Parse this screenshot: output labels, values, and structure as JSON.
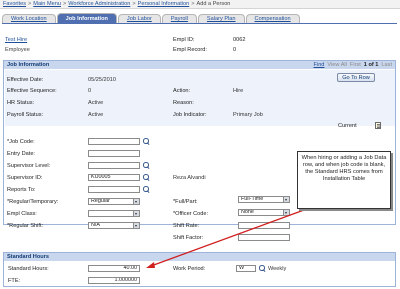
{
  "menubar": {
    "items": [
      "Favorites",
      "Main Menu",
      "Workforce Administration",
      "Personal Information",
      "Add a Person"
    ],
    "separator": ">"
  },
  "tabs": [
    {
      "label": "Work Location",
      "active": false
    },
    {
      "label": "Job Information",
      "active": true
    },
    {
      "label": "Job Labor",
      "active": false
    },
    {
      "label": "Payroll",
      "active": false
    },
    {
      "label": "Salary Plan",
      "active": false
    },
    {
      "label": "Compensation",
      "active": false
    }
  ],
  "header": {
    "name": "Test Hire",
    "role": "Employee",
    "empl_id_label": "Empl ID:",
    "empl_id_value": "0062",
    "empl_record_label": "Empl Record:",
    "empl_record_value": "0"
  },
  "job_panel": {
    "title": "Job Information",
    "nav": {
      "find": "Find",
      "view_all": "View All",
      "first": "First",
      "counter": "1 of 1",
      "last": "Last"
    },
    "go_to_row": "Go To Row",
    "effective_date_label": "Effective Date:",
    "effective_date_value": "05/25/2010",
    "effective_seq_label": "Effective Sequence:",
    "effective_seq_value": "0",
    "action_label": "Action:",
    "action_value": "Hire",
    "hr_status_label": "HR Status:",
    "hr_status_value": "Active",
    "reason_label": "Reason:",
    "reason_value": "",
    "payroll_status_label": "Payroll Status:",
    "payroll_status_value": "Active",
    "job_indicator_label": "Job Indicator:",
    "job_indicator_value": "Primary Job",
    "current_label": "Current",
    "job_code_label": "*Job Code:",
    "job_code_value": "",
    "entry_date_label": "Entry Date:",
    "entry_date_value": "",
    "supervisor_level_label": "Supervisor Level:",
    "supervisor_level_value": "",
    "supervisor_id_label": "Supervisor ID:",
    "supervisor_id_value": "KU0005",
    "supervisor_name": "Reza Alvandi",
    "reports_to_label": "Reports To:",
    "reports_to_value": "",
    "reg_temp_label": "*Regular/Temporary:",
    "reg_temp_value": "Regular",
    "full_part_label": "*Full/Part:",
    "full_part_value": "Full-Time",
    "empl_class_label": "Empl Class:",
    "empl_class_value": "",
    "officer_code_label": "*Officer Code:",
    "officer_code_value": "None",
    "regular_shift_label": "*Regular Shift:",
    "regular_shift_value": "N/A",
    "shift_rate_label": "Shift Rate:",
    "shift_rate_value": "",
    "shift_factor_label": "Shift Factor:",
    "shift_factor_value": ""
  },
  "standard_hours": {
    "title": "Standard Hours",
    "std_hours_label": "Standard Hours:",
    "std_hours_value": "40.00",
    "work_period_label": "Work Period:",
    "work_period_value": "W",
    "work_period_desc": "Weekly",
    "fte_label": "FTE:",
    "fte_value": "1.000000"
  },
  "callout": {
    "text": "When hiring or adding a Job Data row, and when job code is blank, the Standard HRS comes from Installation Table"
  },
  "colors": {
    "tab_active": "#4f6fb1",
    "panel_header": "#c9d7ee",
    "link": "#1f4f9a",
    "arrow": "#d11f1f"
  }
}
